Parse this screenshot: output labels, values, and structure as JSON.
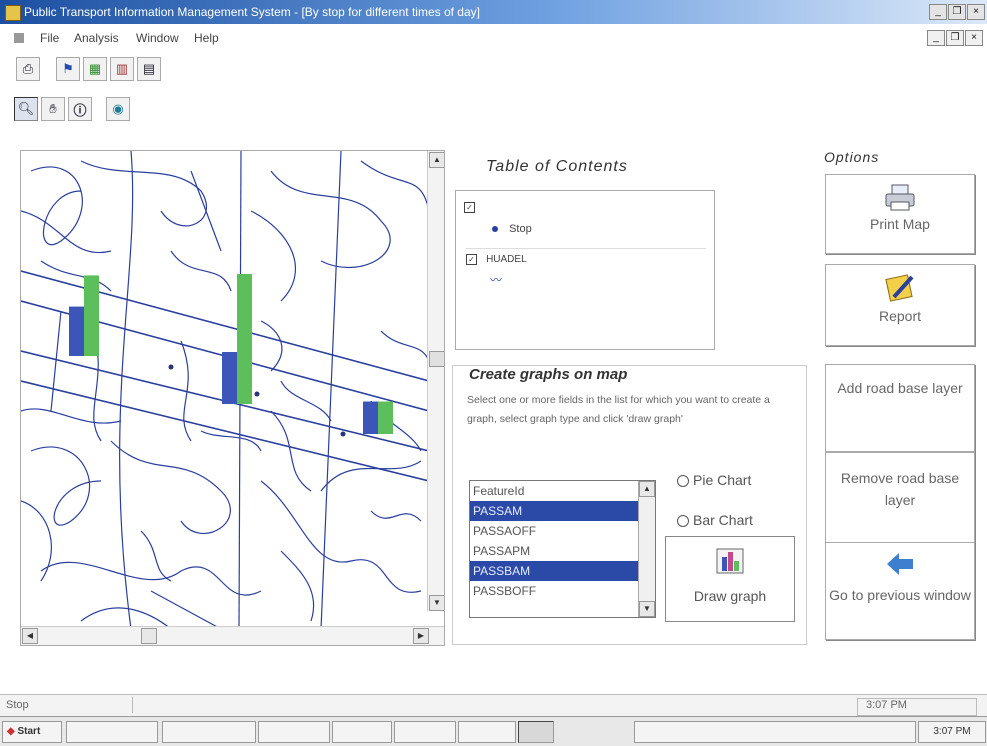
{
  "window": {
    "title": "Public Transport Information Management System - [By stop for different times of day]",
    "min": "_",
    "restore": "❐",
    "close": "×"
  },
  "menu": {
    "items": [
      "File",
      "Analysis",
      "Window",
      "Help"
    ]
  },
  "toolbar1": {
    "icons": [
      "print-icon",
      "flag-icon",
      "layers-icon",
      "chart-icon",
      "document-icon"
    ]
  },
  "toolbar2": {
    "icons": [
      "zoom-icon",
      "pan-icon",
      "info-icon",
      "globe-icon"
    ]
  },
  "toc": {
    "title": "Table of Contents",
    "layers": [
      {
        "name": "Stop",
        "checked": true
      },
      {
        "name": "HUADEL",
        "checked": true
      }
    ]
  },
  "graph_panel": {
    "title": "Create graphs on map",
    "description": "Select one or more fields in the list for which you want to create a graph, select graph type and click 'draw graph'",
    "fields": [
      {
        "name": "FeatureId",
        "selected": false
      },
      {
        "name": "PASSAM",
        "selected": true
      },
      {
        "name": "PASSAOFF",
        "selected": false
      },
      {
        "name": "PASSAPM",
        "selected": false
      },
      {
        "name": "PASSBAM",
        "selected": true
      },
      {
        "name": "PASSBOFF",
        "selected": false
      }
    ],
    "pie_chart_label": "Pie Chart",
    "bar_chart_label": "Bar Chart",
    "draw_graph_label": "Draw graph"
  },
  "options": {
    "title": "Options",
    "buttons": [
      "Print Map",
      "Report",
      "Add road base layer",
      "Remove road base layer",
      "Go to previous window"
    ]
  },
  "status": {
    "left": "Stop",
    "time": "3:07 PM"
  },
  "taskbar": {
    "start_label": "Start",
    "clock": "3:07 PM"
  },
  "map": {
    "bar_colors": {
      "series_a": "#3b56b8",
      "series_b": "#5cbf5c"
    },
    "bar_groups": [
      {
        "a": 0.38,
        "b": 0.62
      },
      {
        "a": 0.4,
        "b": 1.0
      },
      {
        "a": 0.25,
        "b": 0.25
      }
    ]
  }
}
